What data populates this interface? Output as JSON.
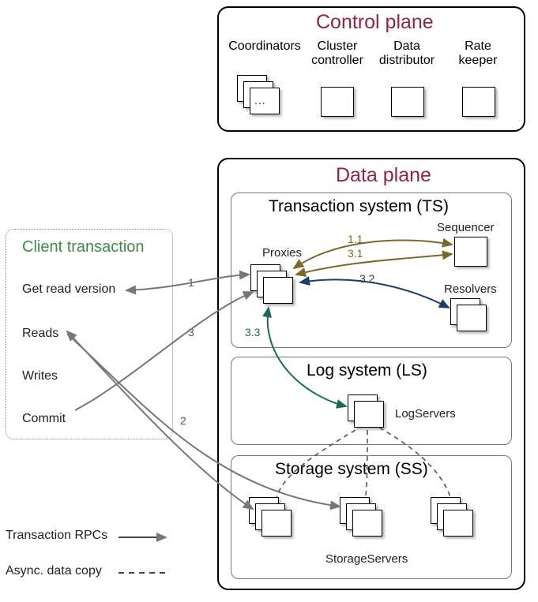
{
  "control_plane": {
    "title": "Control plane",
    "items": [
      {
        "label": "Coordinators"
      },
      {
        "label": "Cluster\ncontroller"
      },
      {
        "label": "Data\ndistributor"
      },
      {
        "label": "Rate\nkeeper"
      }
    ]
  },
  "data_plane": {
    "title": "Data plane",
    "ts": {
      "title": "Transaction system (TS)",
      "proxies": "Proxies",
      "sequencer": "Sequencer",
      "resolvers": "Resolvers",
      "edge_1_1": "1.1",
      "edge_3_1": "3.1",
      "edge_3_2": "3.2",
      "edge_3_3": "3.3"
    },
    "ls": {
      "title": "Log system (LS)",
      "logservers": "LogServers"
    },
    "ss": {
      "title": "Storage system (SS)",
      "storageservers": "StorageServers"
    }
  },
  "client": {
    "title": "Client transaction",
    "items": [
      "Get read version",
      "Reads",
      "Writes",
      "Commit"
    ],
    "edge_1": "1",
    "edge_2": "2",
    "edge_3": "3"
  },
  "legend": {
    "rpc": "Transaction RPCs",
    "async": "Async. data copy"
  }
}
